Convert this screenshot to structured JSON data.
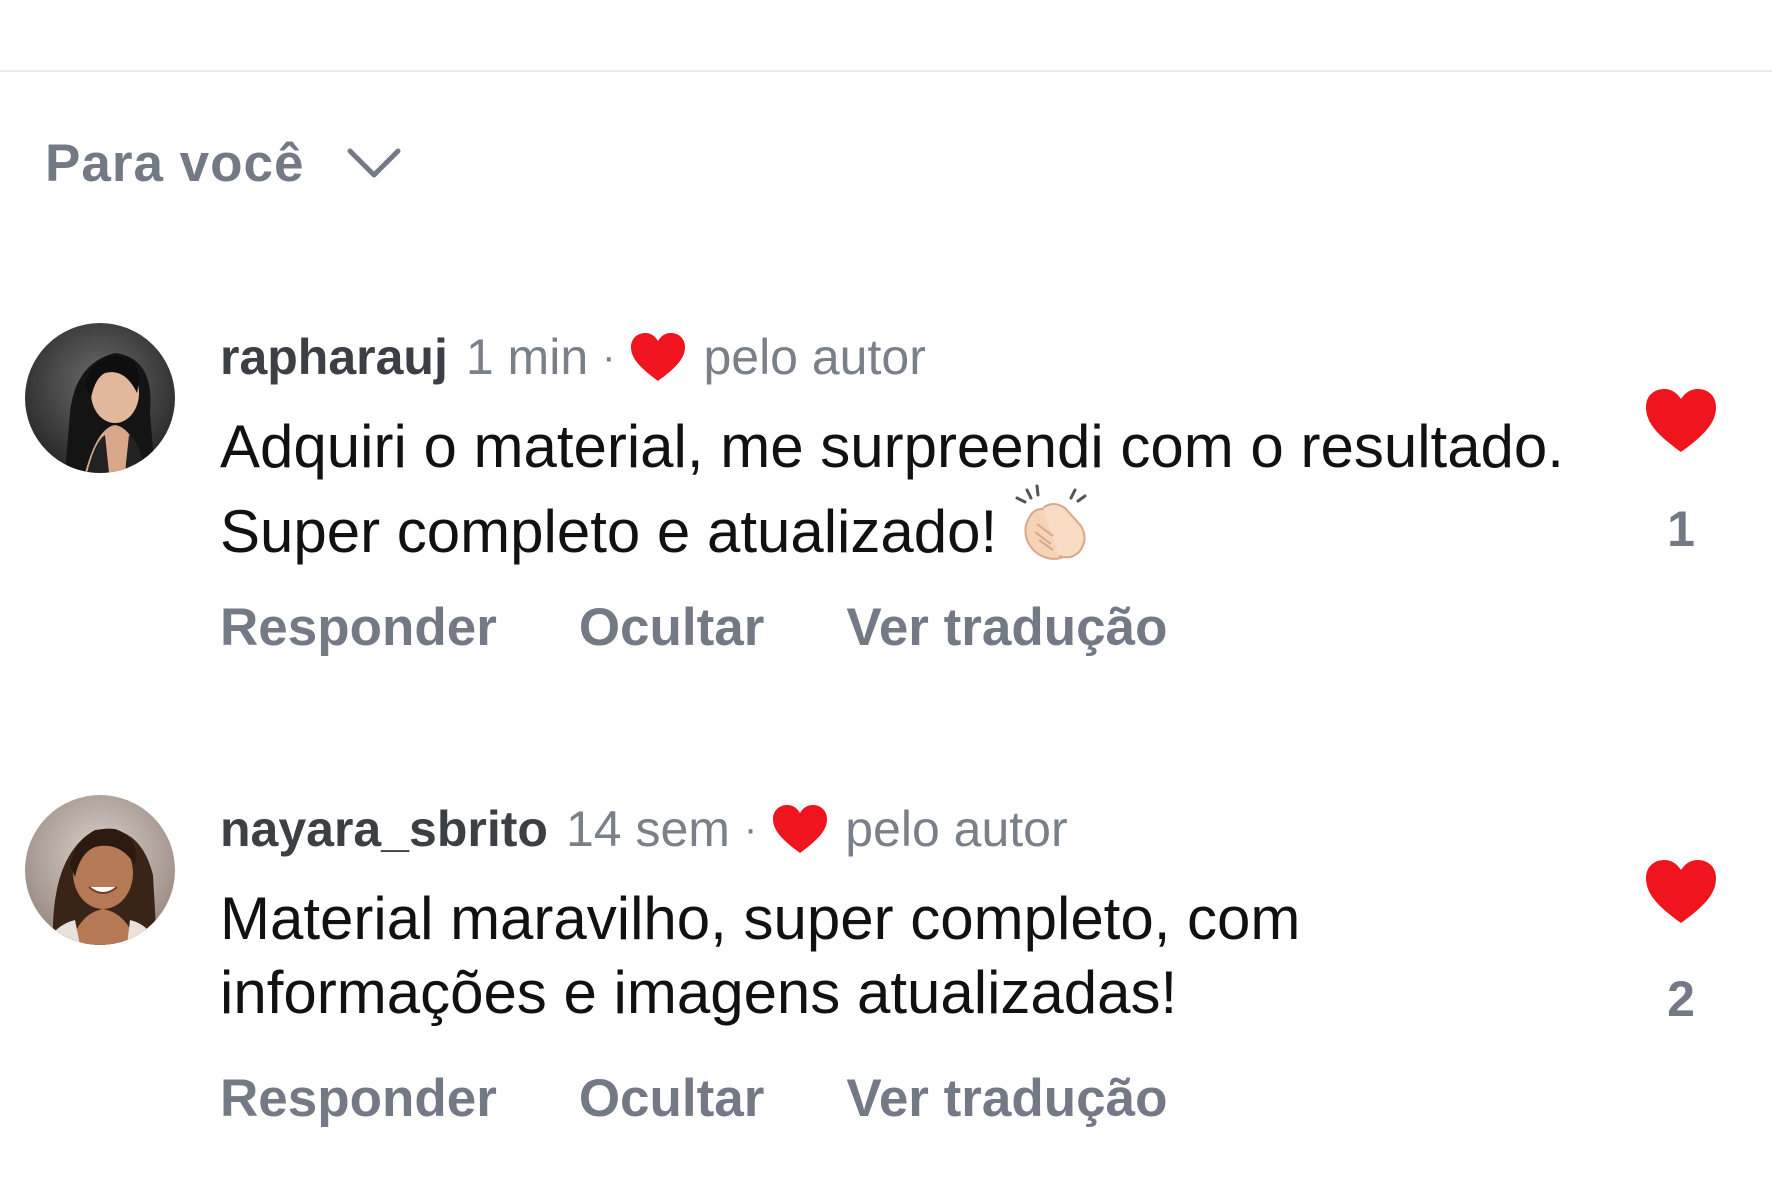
{
  "sort": {
    "label": "Para você",
    "icon": "chevron-down-icon"
  },
  "colors": {
    "heart": "#f0141e",
    "muted": "#737a85",
    "text": "#111111"
  },
  "comments": [
    {
      "username": "rapharauj",
      "time": "1 min",
      "separator": "·",
      "liked_by_author": "pelo autor",
      "text": "Adquiri o material, me surpreendi com o resultado. Super completo e atualizado!",
      "emoji": "clapping-hands-icon",
      "actions": [
        "Responder",
        "Ocultar",
        "Ver tradução"
      ],
      "likes": "1"
    },
    {
      "username": "nayara_sbrito",
      "time": "14 sem",
      "separator": "·",
      "liked_by_author": "pelo autor",
      "text": "Material maravilho, super completo, com informações e imagens atualizadas!",
      "actions": [
        "Responder",
        "Ocultar",
        "Ver tradução"
      ],
      "likes": "2"
    }
  ]
}
